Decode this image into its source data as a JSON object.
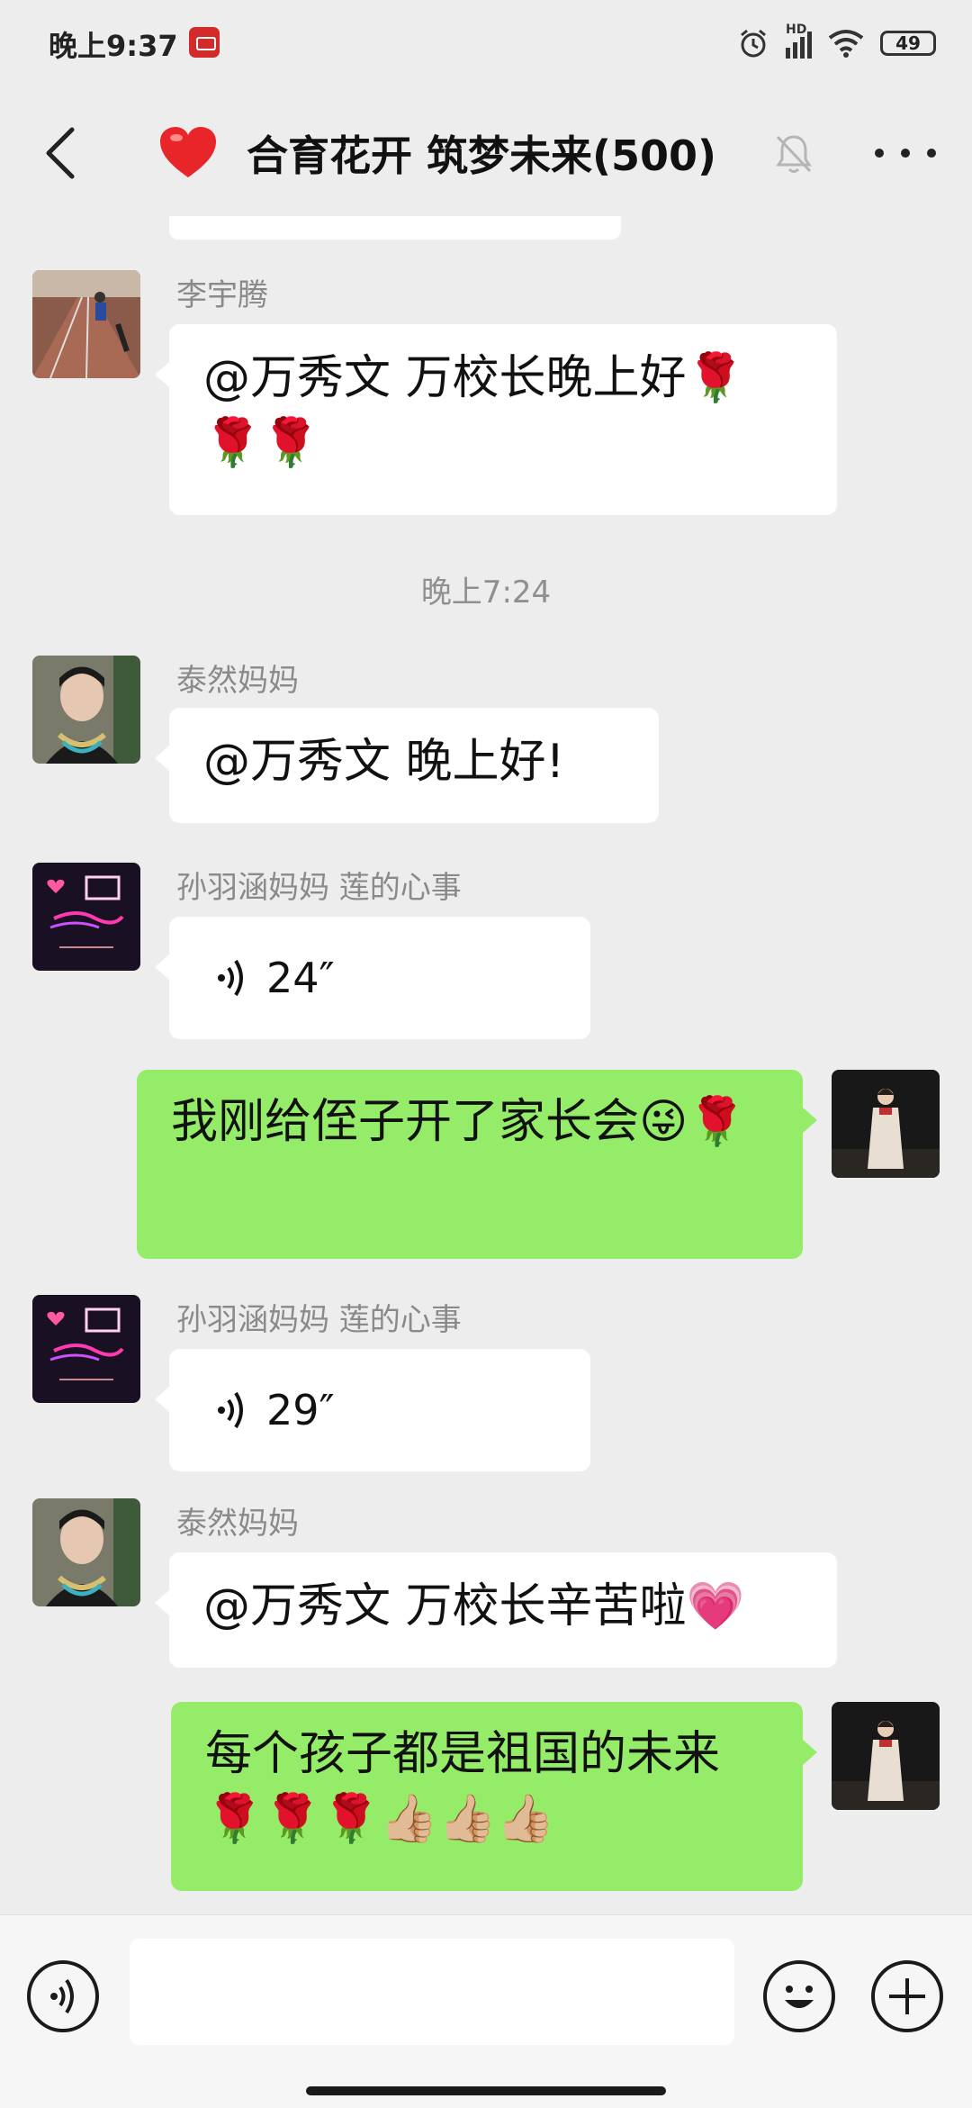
{
  "status_bar": {
    "time": "晚上9:37",
    "network": "HD",
    "battery": "49"
  },
  "header": {
    "title": "合育花开 筑梦未来(500)",
    "heart_color": "#e8262a"
  },
  "colors": {
    "background": "#ededed",
    "incoming_bubble": "#ffffff",
    "outgoing_bubble": "#95ec69"
  },
  "messages": [
    {
      "sender": "李宇腾",
      "text": "@万秀文  万校长晚上好",
      "emoji_tail": "🌹🌹🌹"
    },
    {
      "timestamp": "晚上7:24"
    },
    {
      "sender": "泰然妈妈",
      "text": "@万秀文  晚上好!"
    },
    {
      "sender": "孙羽涵妈妈  莲的心事",
      "voice_duration": "24″"
    },
    {
      "sender": "",
      "text": "我刚给侄子开了家长会",
      "emoji_tail": "😜🌹"
    },
    {
      "sender": "孙羽涵妈妈  莲的心事",
      "voice_duration": "29″"
    },
    {
      "sender": "泰然妈妈",
      "text": "@万秀文  万校长辛苦啦",
      "emoji_tail": "💗"
    },
    {
      "sender": "",
      "text": "每个孩子都是祖国的未来",
      "emoji_tail": "🌹🌹🌹👍🏼👍🏼👍🏼"
    }
  ],
  "input": {
    "placeholder": ""
  }
}
